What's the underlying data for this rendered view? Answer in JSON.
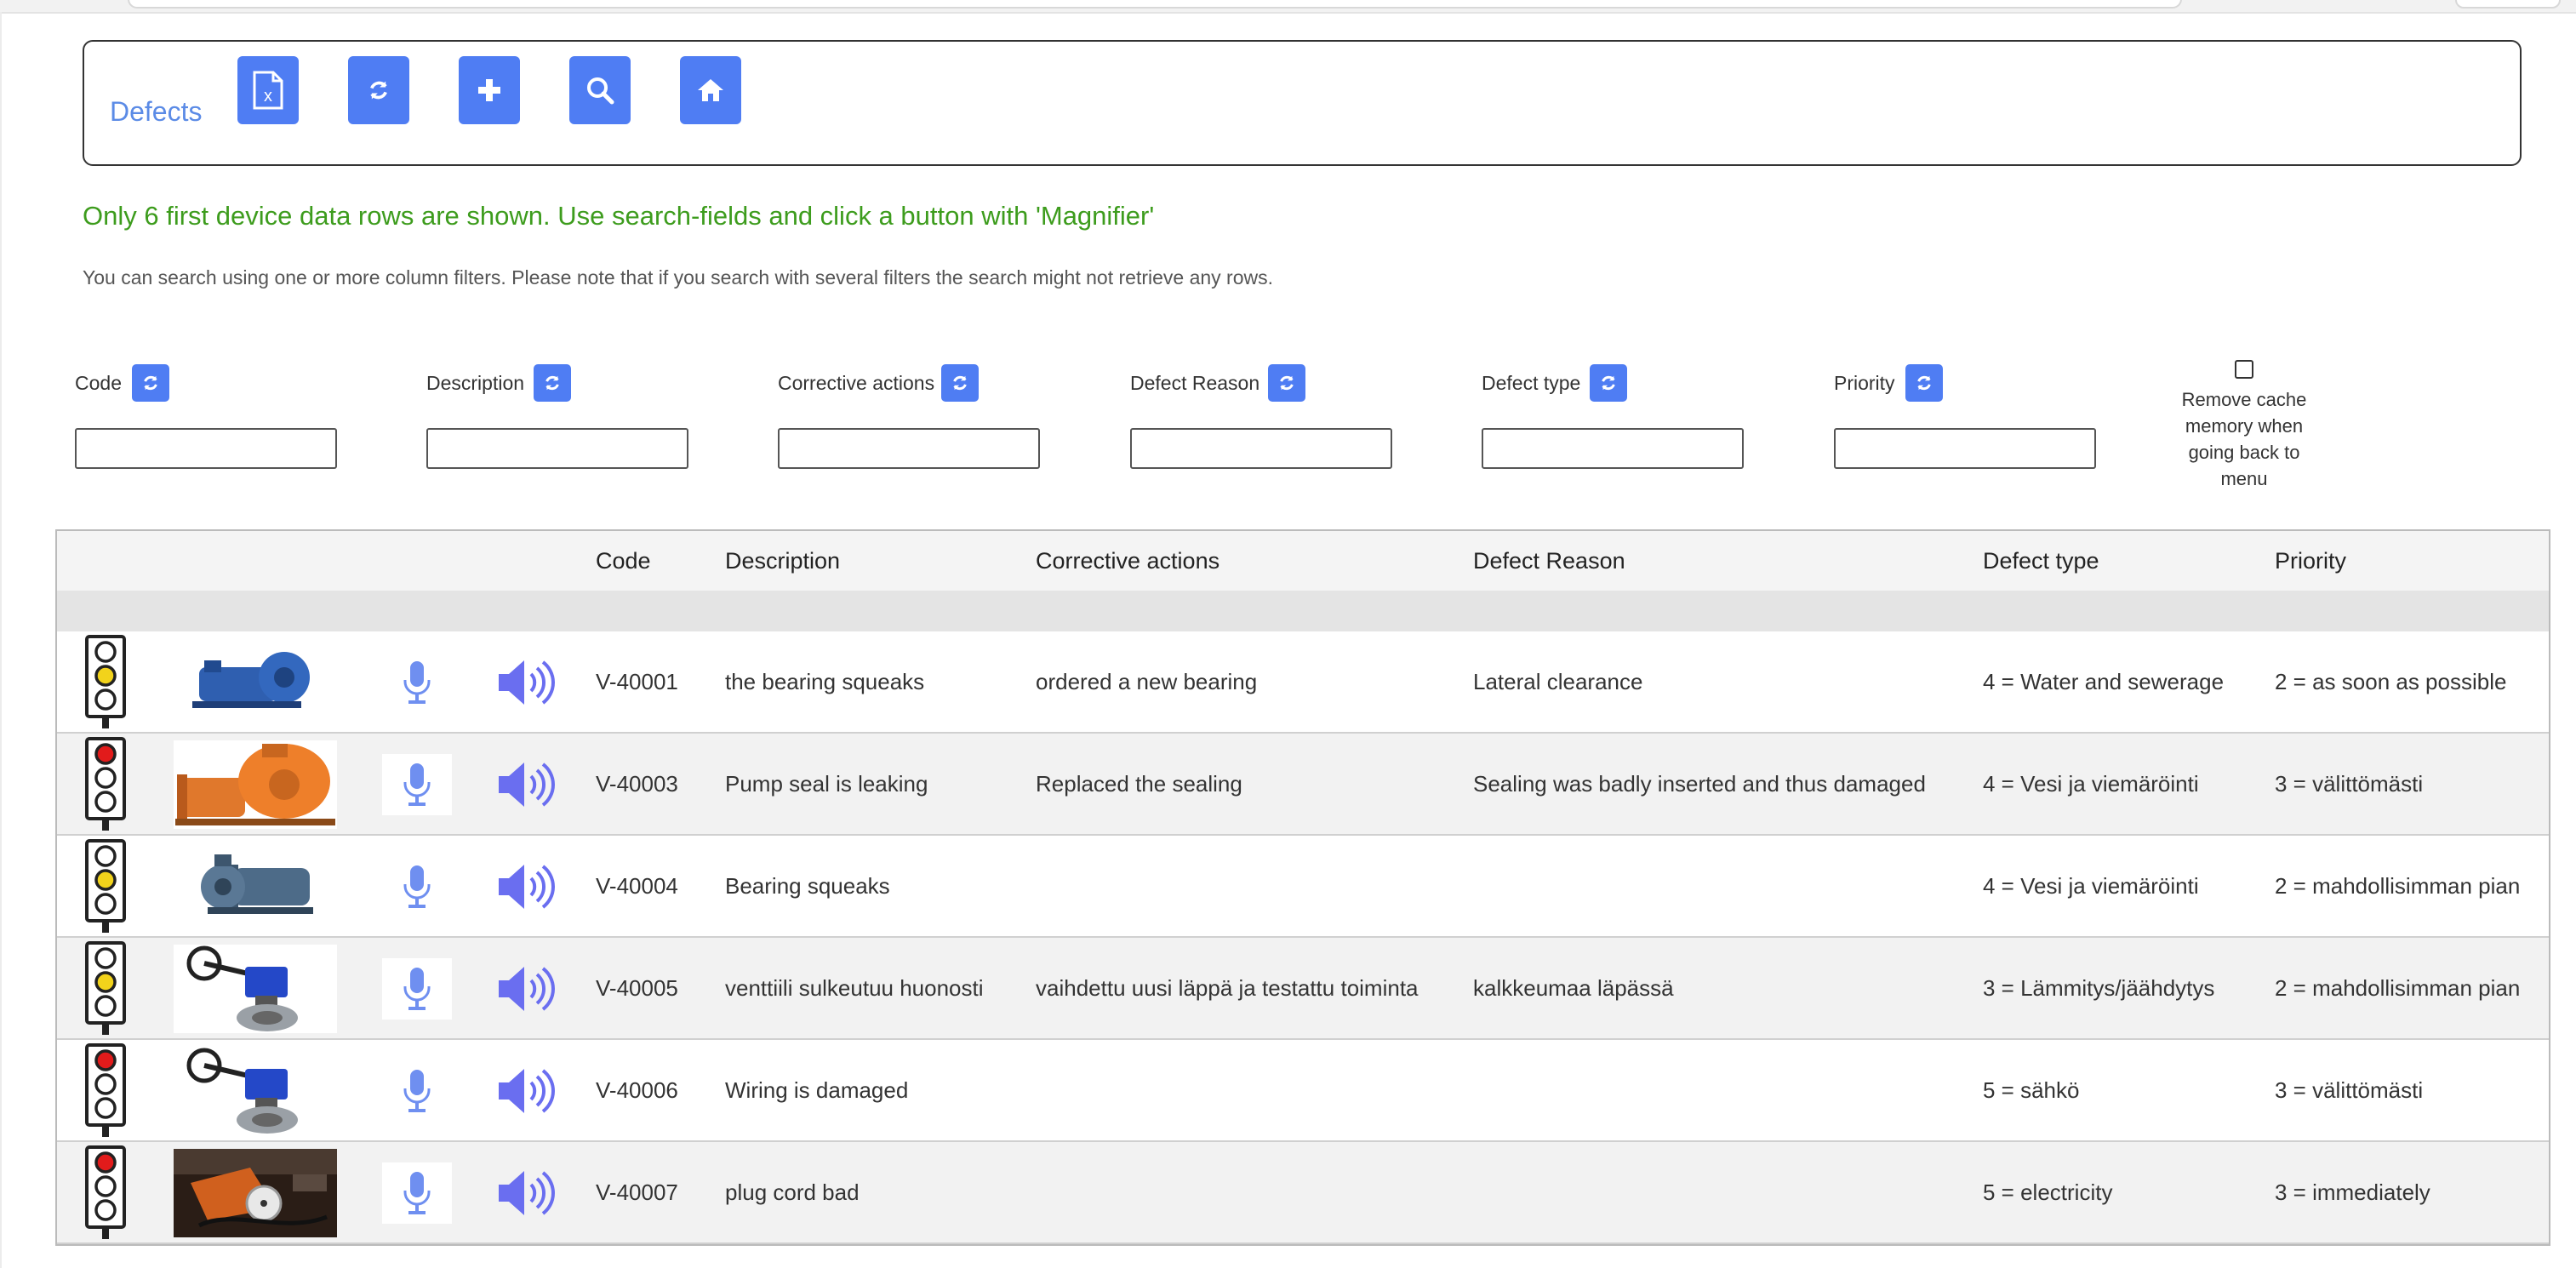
{
  "header": {
    "title": "Defects",
    "toolbar_icons": [
      "excel-export-icon",
      "refresh-icon",
      "plus-icon",
      "search-icon",
      "home-icon"
    ]
  },
  "notice": "Only 6 first device data rows are shown. Use search-fields and click a button with 'Magnifier'",
  "help": "You can search using one or more column filters. Please note that if you search with several filters the search might not retrieve any rows.",
  "filters": [
    {
      "label": "Code",
      "value": ""
    },
    {
      "label": "Description",
      "value": ""
    },
    {
      "label": "Corrective actions",
      "value": ""
    },
    {
      "label": "Defect Reason",
      "value": ""
    },
    {
      "label": "Defect type",
      "value": ""
    },
    {
      "label": "Priority",
      "value": ""
    }
  ],
  "cache_option": {
    "label": "Remove cache memory when going back to menu",
    "checked": false
  },
  "table": {
    "columns": [
      "Code",
      "Description",
      "Corrective actions",
      "Defect Reason",
      "Defect type",
      "Priority"
    ],
    "rows": [
      {
        "status": "yellow",
        "image": "pump-blue",
        "code": "V-40001",
        "description": "the bearing squeaks",
        "corrective": "ordered a new bearing",
        "reason": "Lateral clearance",
        "type": "4 = Water and sewerage",
        "priority": "2 = as soon as possible"
      },
      {
        "status": "red",
        "image": "pump-orange",
        "code": "V-40003",
        "description": "Pump seal is leaking",
        "corrective": "Replaced the sealing",
        "reason": "Sealing was badly inserted and thus damaged",
        "type": "4 = Vesi ja viemäröinti",
        "priority": "3 = välittömästi"
      },
      {
        "status": "yellow",
        "image": "pump-grey",
        "code": "V-40004",
        "description": "Bearing squeaks",
        "corrective": "",
        "reason": "",
        "type": "4 = Vesi ja viemäröinti",
        "priority": "2 = mahdollisimman pian"
      },
      {
        "status": "yellow",
        "image": "valve-blue",
        "code": "V-40005",
        "description": "venttiili sulkeutuu huonosti",
        "corrective": "vaihdettu uusi läppä ja testattu toiminta",
        "reason": "kalkkeumaa läpässä",
        "type": "3 = Lämmitys/jäähdytys",
        "priority": "2 = mahdollisimman pian"
      },
      {
        "status": "red",
        "image": "valve-blue",
        "code": "V-40006",
        "description": "Wiring is damaged",
        "corrective": "",
        "reason": "",
        "type": "5 = sähkö",
        "priority": "3 = välittömästi"
      },
      {
        "status": "red",
        "image": "plug-cord-photo",
        "code": "V-40007",
        "description": "plug cord bad",
        "corrective": "",
        "reason": "",
        "type": "5 = electricity",
        "priority": "3 = immediately"
      }
    ]
  },
  "colors": {
    "accent": "#4f7df3",
    "notice": "#3d9c1d",
    "title": "#5b8be6",
    "mic": "#6f8ff0",
    "speaker": "#6a6ef0"
  }
}
